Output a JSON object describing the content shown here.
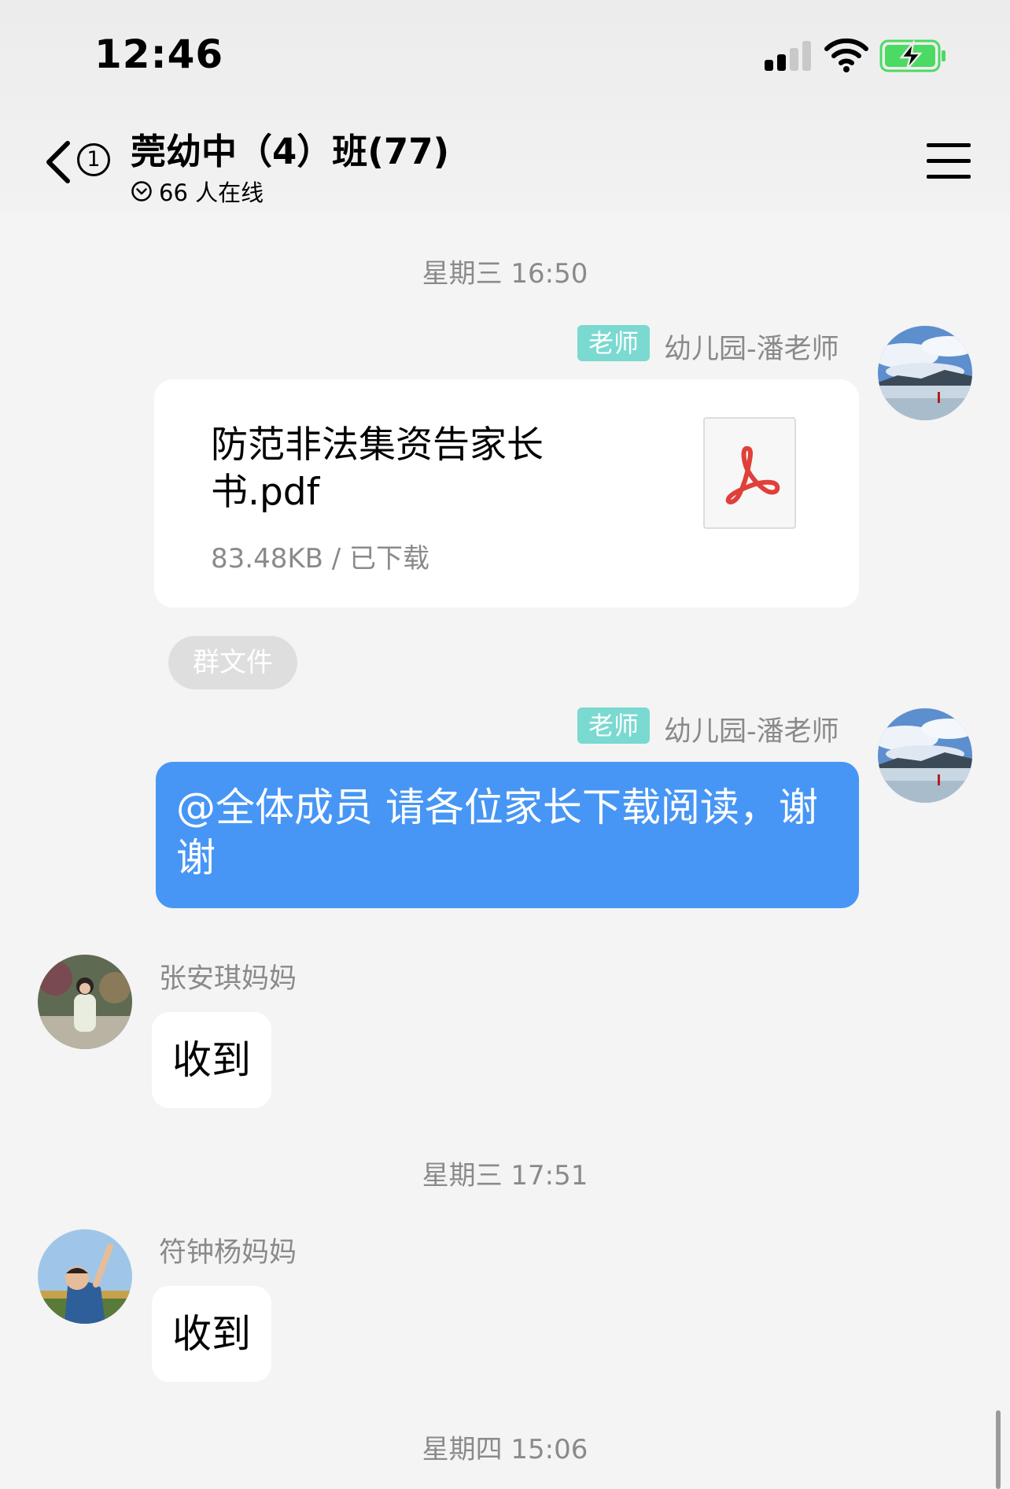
{
  "status_bar": {
    "time": "12:46",
    "signal_icon": "cellular-signal-icon",
    "wifi_icon": "wifi-icon",
    "battery_icon": "battery-charging-icon",
    "battery_color": "#4cd964"
  },
  "header": {
    "back_icon": "chevron-left-icon",
    "unread_count": "1",
    "title": "莞幼中（4）班(77)",
    "online_icon": "chevron-down-circle-icon",
    "online_text": "66 人在线",
    "menu_icon": "hamburger-menu-icon"
  },
  "messages": {
    "ts1": "星期三 16:50",
    "msg1": {
      "role_tag": "老师",
      "sender": "幼儿园-潘老师",
      "file_name": "防范非法集资告家长书.pdf",
      "file_meta": "83.48KB / 已下载",
      "file_icon": "pdf-file-icon"
    },
    "group_file_chip": "群文件",
    "msg2": {
      "role_tag": "老师",
      "sender": "幼儿园-潘老师",
      "text": "@全体成员 请各位家长下载阅读，谢谢"
    },
    "msg3": {
      "sender": "张安琪妈妈",
      "text": "收到"
    },
    "ts2": "星期三 17:51",
    "msg4": {
      "sender": "符钟杨妈妈",
      "text": "收到"
    },
    "ts3": "星期四 15:06"
  },
  "colors": {
    "teacher_tag": "#7ad9d0",
    "own_bubble": "#4796f5",
    "timestamp": "#8a8a8a"
  }
}
